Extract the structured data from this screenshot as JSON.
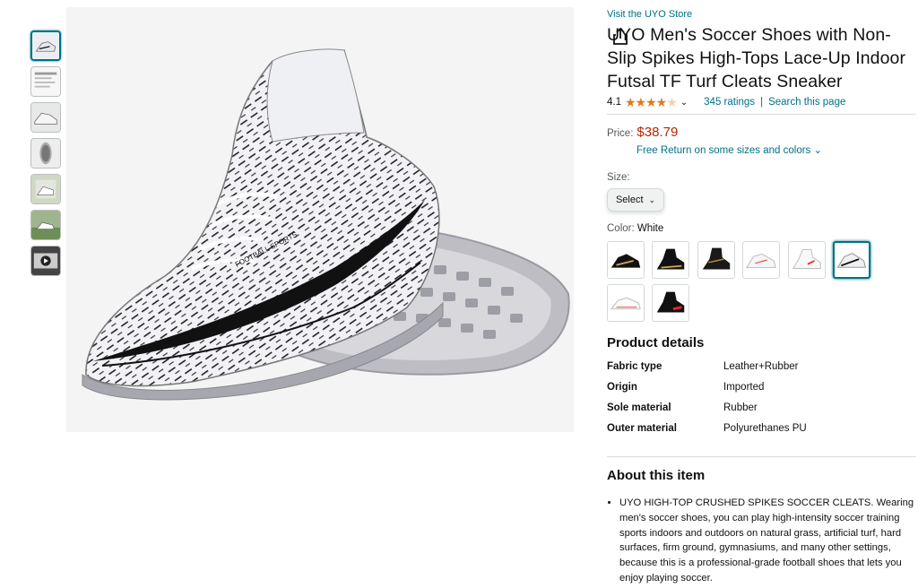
{
  "store_link": "Visit the UYO Store",
  "title": "UYO Men's Soccer Shoes with Non-Slip Spikes High-Tops Lace-Up Indoor Futsal TF Turf Cleats Sneaker",
  "rating": {
    "value": "4.1",
    "stars_filled": 4,
    "count_text": "345 ratings",
    "search_link": "Search this page",
    "separator": "|",
    "chevron": "⌄"
  },
  "price": {
    "label": "Price:",
    "amount": "$38.79",
    "free_return": "Free Return on some sizes and colors ⌄"
  },
  "size": {
    "label": "Size:",
    "selected": "Select",
    "arrow": "⌄"
  },
  "color": {
    "label": "Color: ",
    "value": "White",
    "swatch_names": [
      "black-gold",
      "black-gold-2",
      "black-gold-3",
      "white-red",
      "white-red-2",
      "white-black",
      "white-silver",
      "black-red"
    ],
    "selected_index": 5
  },
  "product_details": {
    "title": "Product details",
    "rows": [
      {
        "key": "Fabric type",
        "value": "Leather+Rubber"
      },
      {
        "key": "Origin",
        "value": "Imported"
      },
      {
        "key": "Sole material",
        "value": "Rubber"
      },
      {
        "key": "Outer material",
        "value": "Polyurethanes PU"
      }
    ]
  },
  "about": {
    "title": "About this item",
    "bullets": [
      "UYO HIGH-TOP CRUSHED SPIKES SOCCER CLEATS. Wearing men's soccer shoes, you can play high-intensity soccer training sports indoors and outdoors on natural grass, artificial turf, hard surfaces, firm ground, gymnasiums, and many other settings, because this is a professional-grade football shoes that lets you enjoy playing soccer."
    ]
  },
  "image_text": {
    "shoe_label": "FOOTBALL SPORTS"
  },
  "colors": {
    "link": "#007185",
    "price": "#b12704",
    "star": "#de7921",
    "text": "#0f1111"
  },
  "icons": {
    "share": "share-icon",
    "star": "star-icon"
  }
}
